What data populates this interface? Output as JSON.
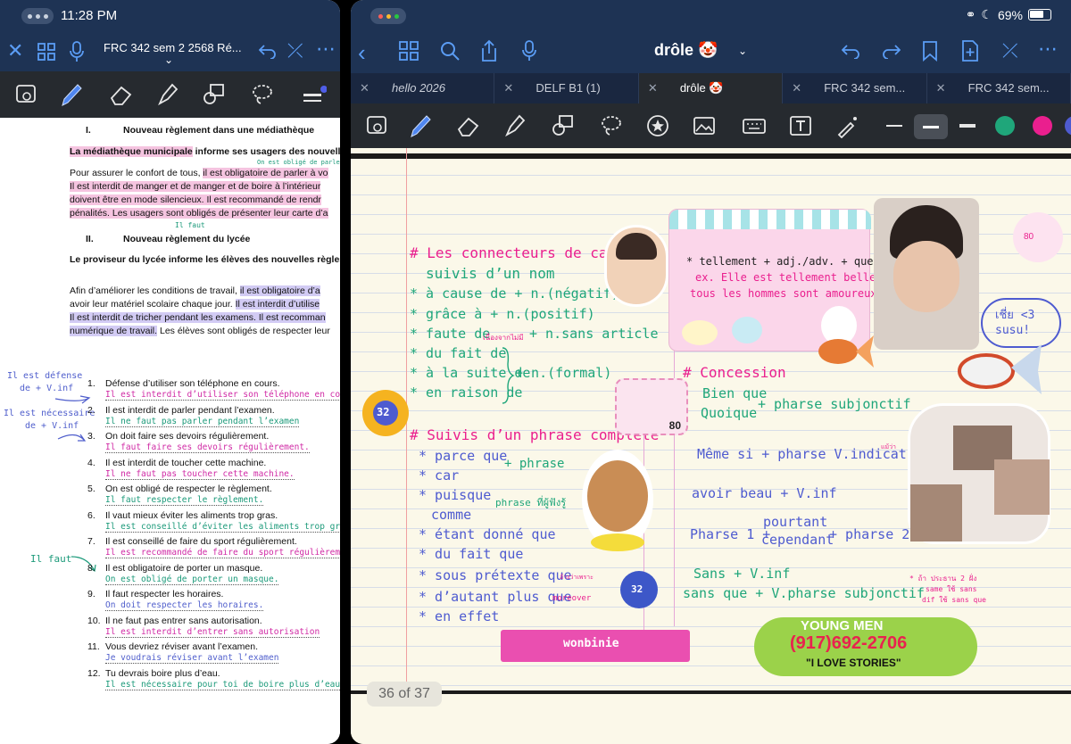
{
  "left": {
    "status": {
      "time": "11:28 PM"
    },
    "nav": {
      "doc_title": "FRC 342 sem 2  2568 Ré..."
    },
    "doc": {
      "h1": "I.",
      "h1_text": "Nouveau règlement dans une médiathèque",
      "intro_a": "La médiathèque municipale",
      "intro_b": " informe ses usagers des nouvelle",
      "annot_top": "On est obligé de parler à voix",
      "p1_a": "Pour assurer le confort de tous, ",
      "p1_b": "il est obligatoire de parler à vo",
      "p2": "Il est interdit de manger et de manger et de boire à l’intérieur",
      "p3_a": "doivent être en mode silencieux.",
      "p3_b": "  Il est recommandé de rendr",
      "p4": "pénalités. Les usagers sont obligés de présenter leur carte d’a",
      "annot_faut": "Il faut",
      "h2": "II.",
      "h2_text": "Nouveau règlement du lycée",
      "lycee_intro": "Le proviseur du lycée informe les élèves des nouvelles règles",
      "q1_a": "Afin d’améliorer les conditions de travail, ",
      "q1_b": "il est obligatoire d’a",
      "q2_a": "avoir leur matériel scolaire chaque jour. ",
      "q2_b": "Il est interdit d’utilise",
      "q3": "Il est interdit de tricher pendant les examens. Il est recomman",
      "q4_a": "numérique de travail.",
      "q4_b": " Les élèves sont obligés de respecter leur",
      "side1_a": "Il est défense",
      "side1_b": "de + V.inf",
      "side2_a": "Il est nécessaire",
      "side2_b": "de + V.inf",
      "side3": "Il faut",
      "items": [
        {
          "num": "1.",
          "text": "Défense d’utiliser son téléphone en cours.",
          "ans": "Il est interdit d’utiliser son téléphone en cours."
        },
        {
          "num": "2.",
          "text": "Il est interdit de parler pendant l’examen.",
          "ans": "Il ne faut pas parler pendant l’examen"
        },
        {
          "num": "3.",
          "text": "On doit faire ses devoirs régulièrement.",
          "ans": "Il faut faire ses devoirs régulièrement."
        },
        {
          "num": "4.",
          "text": "Il est interdit de toucher cette machine.",
          "ans": "Il ne faut pas toucher cette machine."
        },
        {
          "num": "5.",
          "text": "On est obligé de respecter le règlement.",
          "ans": "Il faut respecter le règlement."
        },
        {
          "num": "6.",
          "text": "Il vaut mieux éviter les aliments trop gras.",
          "ans": "Il est conseillé d’éviter les aliments trop gras."
        },
        {
          "num": "7.",
          "text": "Il est conseillé de faire du sport régulièrement.",
          "ans": "Il est recommandé de faire du sport régulièrement"
        },
        {
          "num": "8.",
          "text": "Il est obligatoire de porter un masque.",
          "ans": "On est obligé de porter un masque."
        },
        {
          "num": "9.",
          "text": "Il faut respecter les horaires.",
          "ans": "On doit respecter les horaires."
        },
        {
          "num": "10.",
          "text": "Il ne faut pas entrer sans autorisation.",
          "ans": "Il est interdit d’entrer sans autorisation"
        },
        {
          "num": "11.",
          "text": "Vous devriez réviser avant l’examen.",
          "ans": "Je voudrais réviser avant l’examen"
        },
        {
          "num": "12.",
          "text": "Tu devrais boire plus d’eau.",
          "ans": "Il est nécessaire pour toi de boire plus d’eau."
        }
      ]
    }
  },
  "right": {
    "status": {
      "battery": "69%"
    },
    "title": "drôle 🤡",
    "tabs": [
      "hello 2026",
      "DELF B1 (1)",
      "drôle 🤡",
      "FRC 342 sem...",
      "FRC 342 sem..."
    ],
    "page_indicator": "36 of 37",
    "colors": {
      "green": "#1fa67a",
      "pink": "#ea1f8e",
      "blue": "#4e5bd0",
      "accent": "#5b9df5"
    },
    "notes": {
      "h_cause": "# Les connecteurs de cause",
      "suivis_nom": "suivis d’un nom",
      "c1": "* à cause de + n.(négatif)",
      "c2": "* grâce à + n.(positif)",
      "c3": "* faute de",
      "c3_note": "เนื่องจากไม่มี",
      "c3_b": "+ n.sans article",
      "c4": "* du fait de",
      "c5": "* à la suite de",
      "c5_b": "+ n.(formal)",
      "c6": "* en raison de",
      "h_phrase": "# Suivis d’un phrase complète",
      "p1": "* parce que",
      "p1_b": "+ phrase",
      "p2": "* car",
      "p3": "* puisque",
      "p3_b": "phrase ที่ผู้ฟังรู้",
      "p4": "comme",
      "p5": "* étant donné que",
      "p6": "* du fait que",
      "p7": "* sous prétexte que",
      "p7_note": "อ้างว่าเพราะ",
      "p8": "* d’autant plus que",
      "p8_note": "moreover",
      "p9": "* en effet",
      "tel1": "* tellement + adj./adv. + que + pharse",
      "tel2": "ex. Elle est tellement belle que",
      "tel3": "tous les hommes sont amoureux.",
      "h_conc": "# Concession",
      "k1": "Bien que",
      "k2": "Quoique",
      "k2_b": "+ pharse subjonctif",
      "k3": "Même si + pharse V.indicatif",
      "k3_note": "แม้ว่า",
      "k4": "avoir beau + V.inf",
      "k5": "Pharse 1 +",
      "k5_top": "pourtant",
      "k5_bot": "cependant",
      "k5_b": "+ pharse 2",
      "k6": "Sans + V.inf",
      "k7": "sans que + V.pharse subjonctif",
      "k7_note1": "* ถ้า ประธาน 2 ฝั่ง",
      "k7_note2": "same ใช้ sans",
      "k7_note3": "dif ใช้ sans que",
      "heart": "เชี่ย <3 susu!",
      "sticker_32": "32",
      "sticker_80": "80",
      "wonbinie": "wonbinie",
      "ym_1": "YOUNG MEN",
      "ym_2": "(917)692-2706",
      "ym_3": "\"I LOVE STORIES\""
    }
  }
}
